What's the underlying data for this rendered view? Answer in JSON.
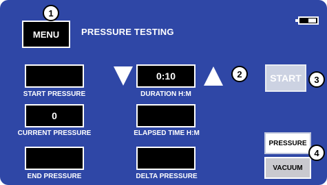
{
  "header": {
    "menu_label": "MENU",
    "title": "PRESSURE TESTING"
  },
  "battery": {
    "level": 0.45,
    "icon": "battery-icon"
  },
  "fields": {
    "start_pressure": {
      "value": "",
      "label": "START PRESSURE"
    },
    "duration": {
      "value": "0:10",
      "label": "DURATION H:M"
    },
    "current_pressure": {
      "value": "0",
      "label": "CURRENT PRESSURE"
    },
    "elapsed_time": {
      "value": "",
      "label": "ELAPSED TIME H:M"
    },
    "end_pressure": {
      "value": "",
      "label": "END PRESSURE"
    },
    "delta_pressure": {
      "value": "",
      "label": "DELTA PRESSURE"
    }
  },
  "controls": {
    "decrease_icon": "triangle-down-icon",
    "increase_icon": "triangle-up-icon",
    "start_label": "START",
    "pressure_label": "PRESSURE",
    "vacuum_label": "VACUUM"
  },
  "callouts": [
    "1",
    "2",
    "3",
    "4"
  ],
  "colors": {
    "background": "#2f47a6",
    "field": "#000000",
    "text": "#ffffff",
    "start_disabled": "#ccd2e2"
  }
}
